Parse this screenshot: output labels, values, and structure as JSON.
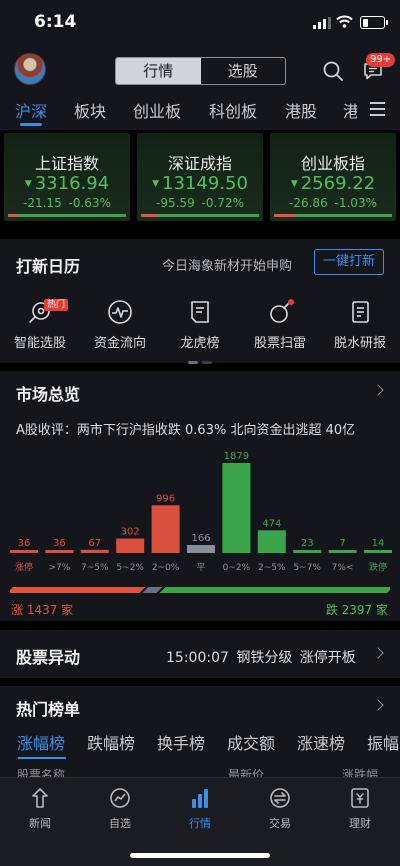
{
  "status_bar": {
    "time": "6:14",
    "battery_level": 0.3
  },
  "header": {
    "tabs": [
      "行情",
      "选股"
    ],
    "active_tab": 0,
    "message_badge": "99+"
  },
  "market_tabs": {
    "items": [
      "沪深",
      "板块",
      "创业板",
      "科创板",
      "港股",
      "港"
    ],
    "active": 0
  },
  "indices": [
    {
      "name": "上证指数",
      "value": "3316.94",
      "change": "-21.15",
      "change_pct": "-0.63%",
      "up_ratio": 0.08
    },
    {
      "name": "深证成指",
      "value": "13149.50",
      "change": "-95.59",
      "change_pct": "-0.72%",
      "up_ratio": 0.14
    },
    {
      "name": "创业板指",
      "value": "2569.22",
      "change": "-26.86",
      "change_pct": "-1.03%",
      "up_ratio": 0.18
    }
  ],
  "ipo": {
    "title": "打新日历",
    "subtitle": "今日海象新材开始申购",
    "button": "一键打新",
    "hot_tag": "热门"
  },
  "tools": [
    {
      "label": "智能选股",
      "icon": "rocket-icon"
    },
    {
      "label": "资金流向",
      "icon": "pulse-icon"
    },
    {
      "label": "龙虎榜",
      "icon": "list-doc-icon"
    },
    {
      "label": "股票扫雷",
      "icon": "bomb-icon"
    },
    {
      "label": "脱水研报",
      "icon": "report-icon"
    }
  ],
  "market_overview": {
    "title": "市场总览",
    "summary": "A股收评：两市下行沪指收跌 0.63% 北向资金出逃超 40亿",
    "rise_label": "涨 1437 家",
    "fall_label": "跌 2397 家",
    "rise_count": 1437,
    "fall_count": 2397
  },
  "chart_data": {
    "type": "bar",
    "categories": [
      "涨停",
      ">7%",
      "7~5%",
      "5~2%",
      "2~0%",
      "平",
      "0~2%",
      "2~5%",
      "5~7%",
      "7%<",
      "跌停"
    ],
    "values": [
      36,
      36,
      67,
      302,
      996,
      166,
      1879,
      474,
      23,
      7,
      14
    ],
    "colors": [
      "#d9503f",
      "#d9503f",
      "#d9503f",
      "#d9503f",
      "#d9503f",
      "#8b8f99",
      "#3aa64b",
      "#3aa64b",
      "#3aa64b",
      "#3aa64b",
      "#3aa64b"
    ],
    "ylim": [
      0,
      1879
    ]
  },
  "stock_moves": {
    "title": "股票异动",
    "time": "15:00:07",
    "sector": "钢铁分级",
    "event": "涨停开板"
  },
  "hot_lists": {
    "title": "热门榜单",
    "tabs": [
      "涨幅榜",
      "跌幅榜",
      "换手榜",
      "成交额",
      "涨速榜",
      "振幅"
    ],
    "active": 0,
    "columns": [
      "股票名称",
      "最新价",
      "涨跌幅"
    ]
  },
  "tabbar": {
    "items": [
      {
        "label": "新闻",
        "icon": "news-icon"
      },
      {
        "label": "自选",
        "icon": "watchlist-icon"
      },
      {
        "label": "行情",
        "icon": "market-icon"
      },
      {
        "label": "交易",
        "icon": "trade-icon"
      },
      {
        "label": "理财",
        "icon": "wealth-icon"
      }
    ],
    "active": 2
  },
  "colors": {
    "accent": "#3a8ee6",
    "rise": "#d9503f",
    "fall": "#4fbf5e",
    "panel": "#14161c"
  }
}
